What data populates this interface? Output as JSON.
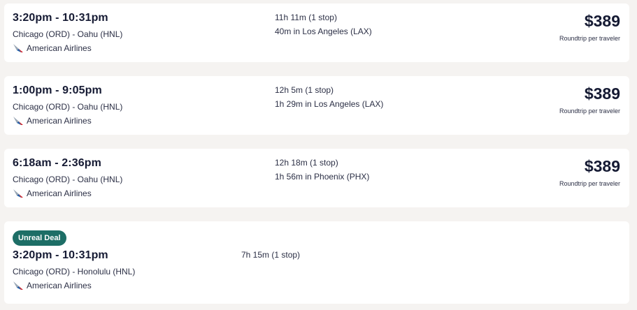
{
  "results": [
    {
      "times": "3:20pm - 10:31pm",
      "route": "Chicago (ORD) - Oahu (HNL)",
      "airline": "American Airlines",
      "duration": "11h 11m (1 stop)",
      "layover": "40m in Los Angeles (LAX)",
      "price": "$389",
      "price_note": "Roundtrip per traveler"
    },
    {
      "times": "1:00pm - 9:05pm",
      "route": "Chicago (ORD) - Oahu (HNL)",
      "airline": "American Airlines",
      "duration": "12h 5m (1 stop)",
      "layover": "1h 29m in Los Angeles (LAX)",
      "price": "$389",
      "price_note": "Roundtrip per traveler"
    },
    {
      "times": "6:18am - 2:36pm",
      "route": "Chicago (ORD) - Oahu (HNL)",
      "airline": "American Airlines",
      "duration": "12h 18m (1 stop)",
      "layover": "1h 56m in Phoenix (PHX)",
      "price": "$389",
      "price_note": "Roundtrip per traveler"
    },
    {
      "badge": "Unreal Deal",
      "times": "3:20pm - 10:31pm",
      "route": "Chicago (ORD) - Honolulu (HNL)",
      "airline": "American Airlines",
      "duration": "7h 15m (1 stop)"
    }
  ],
  "colors": {
    "background": "#f5f3f1",
    "card": "#ffffff",
    "badge": "#1d6e66",
    "text": "#151a33"
  },
  "icons": {
    "airline_logo": "american-airlines-logo-icon"
  }
}
